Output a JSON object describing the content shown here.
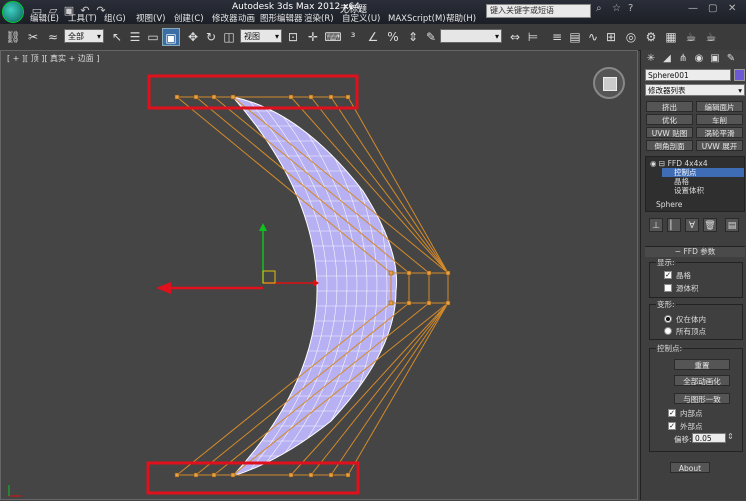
{
  "titlebar": {
    "app_title": "Autodesk 3ds Max  2012 x64",
    "file_name": "无标题",
    "search_placeholder": "键入关键字或短语",
    "menus": [
      "编辑(E)",
      "工具(T)",
      "组(G)",
      "视图(V)",
      "创建(C)",
      "修改器",
      "动画",
      "图形编辑器",
      "渲染(R)",
      "自定义(U)",
      "MAXScript(M)",
      "帮助(H)"
    ]
  },
  "toolbar": {
    "selection_filter": "全部",
    "reference_coord": "视图"
  },
  "viewport": {
    "label": "[ + ][ 顶 ][ 真实 + 边面 ]"
  },
  "command_panel": {
    "object_name": "Sphere001",
    "object_color": "#6b59d6",
    "modifier_list": "修改器列表",
    "modifier_buttons": [
      "挤出",
      "编辑面片",
      "优化",
      "车削",
      "UVW 贴图",
      "涡轮平滑",
      "倒角剖面",
      "UVW 展开"
    ],
    "stack": {
      "modifier": "FFD 4x4x4",
      "sub_items": [
        "控制点",
        "晶格",
        "设置体积"
      ],
      "selected": "控制点",
      "base": "Sphere"
    },
    "ffd_params": {
      "title": "FFD 参数",
      "display_group": "显示:",
      "lattice_label": "晶格",
      "lattice_checked": true,
      "source_volume_label": "源体积",
      "source_volume_checked": false,
      "deform_group": "变形:",
      "only_in_volume_label": "仅在体内",
      "all_vertices_label": "所有顶点",
      "deform_mode": "only_in_volume",
      "control_points_group": "控制点:",
      "reset_button": "重置",
      "animate_all_button": "全部动画化",
      "conform_button": "与图形一致",
      "inside_points_label": "内部点",
      "inside_points_checked": true,
      "outside_points_label": "外部点",
      "outside_points_checked": true,
      "offset_label": "偏移:",
      "offset_value": "0.05",
      "about_button": "About"
    }
  },
  "colors": {
    "highlight_box": "#e0101c",
    "lattice": "#d48a2a",
    "mesh_fill": "#b7b0f2",
    "gizmo_x": "#e01010",
    "gizmo_y": "#10c020"
  }
}
